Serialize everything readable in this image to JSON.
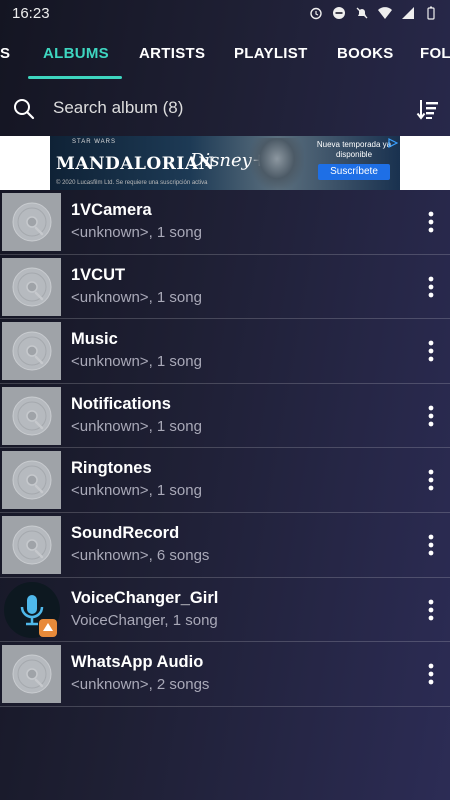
{
  "status_bar": {
    "time": "16:23"
  },
  "tabs": [
    {
      "label": "S"
    },
    {
      "label": "ALBUMS",
      "active": true
    },
    {
      "label": "ARTISTS"
    },
    {
      "label": "PLAYLIST"
    },
    {
      "label": "BOOKS"
    },
    {
      "label": "FOL"
    }
  ],
  "search": {
    "placeholder": "Search album (8)"
  },
  "ad": {
    "small_top": "STAR WARS",
    "title": "MANDALORIAN",
    "brand": "Disney+",
    "legal": "© 2020 Lucasfilm Ltd. Se requiere una suscripción activa",
    "promo": "Nueva temporada ya disponible",
    "cta": "Suscríbete"
  },
  "albums": [
    {
      "name": "1VCamera",
      "subtitle": "<unknown>, 1 song",
      "icon": "disc-icon"
    },
    {
      "name": "1VCUT",
      "subtitle": "<unknown>, 1 song",
      "icon": "disc-icon"
    },
    {
      "name": "Music",
      "subtitle": "<unknown>, 1 song",
      "icon": "disc-icon"
    },
    {
      "name": "Notifications",
      "subtitle": "<unknown>, 1 song",
      "icon": "disc-icon"
    },
    {
      "name": "Ringtones",
      "subtitle": "<unknown>, 1 song",
      "icon": "disc-icon"
    },
    {
      "name": "SoundRecord",
      "subtitle": "<unknown>, 6 songs",
      "icon": "disc-icon"
    },
    {
      "name": "VoiceChanger_Girl",
      "subtitle": "VoiceChanger, 1 song",
      "icon": "microphone-icon"
    },
    {
      "name": "WhatsApp Audio",
      "subtitle": "<unknown>, 2 songs",
      "icon": "disc-icon"
    }
  ],
  "colors": {
    "accent": "#3ed6c0",
    "thumb_bg": "#9fa3a8",
    "subtext": "#a9a9b8"
  }
}
